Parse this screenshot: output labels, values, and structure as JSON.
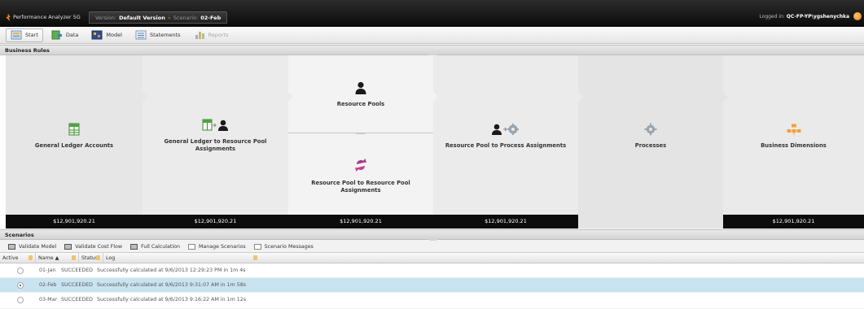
{
  "app": {
    "title": "Performance Analyzer 5G",
    "version_label": "Version:",
    "version_value": "Default Version",
    "scenario_label": "Scenario:",
    "scenario_value": "02-Feb",
    "logged_label": "Logged in:",
    "logged_user": "QC-FP-YP\\ygshenychka"
  },
  "toolbar": {
    "start": "Start",
    "data": "Data",
    "model": "Model",
    "statements": "Statements",
    "reports": "Reports"
  },
  "business_rules": {
    "header": "Business Rules",
    "gl_accounts": {
      "label": "General Ledger Accounts",
      "total": "$12,901,920.21"
    },
    "gl_to_rp": {
      "label": "General Ledger to Resource Pool Assignments",
      "total": "$12,901,920.21"
    },
    "resource_pools": {
      "label": "Resource Pools",
      "total": "$12,901,920.21"
    },
    "rp_to_rp": {
      "label": "Resource Pool to Resource Pool Assignments"
    },
    "rp_to_process": {
      "label": "Resource Pool to Process Assignments",
      "total": "$12,901,920.21"
    },
    "processes": {
      "label": "Processes"
    },
    "business_dimensions": {
      "label": "Business Dimensions",
      "total": "$12,901,920.21"
    }
  },
  "scenarios": {
    "header": "Scenarios",
    "toolbar": {
      "validate_model": "Validate Model",
      "validate_cost_flow": "Validate Cost Flow",
      "full_calculation": "Full Calculation",
      "manage_scenarios": "Manage Scenarios",
      "scenario_messages": "Scenario Messages"
    },
    "columns": {
      "active": "Active",
      "name": "Name",
      "status": "Status",
      "log": "Log"
    },
    "rows": [
      {
        "name": "01-Jan",
        "status": "SUCCEEDED",
        "log": "Successfully calculated at 9/6/2013 12:29:23 PM in 1m 4s",
        "active": false
      },
      {
        "name": "02-Feb",
        "status": "SUCCEEDED",
        "log": "Successfully calculated at 9/6/2013 9:31:07 AM in 1m 58s",
        "active": true
      },
      {
        "name": "03-Mar",
        "status": "SUCCEEDED",
        "log": "Successfully calculated at 9/6/2013 9:16:22 AM in 1m 12s",
        "active": false
      }
    ]
  },
  "colors": {
    "accent_orange": "#e07d16",
    "selected_row": "#c9e3f0",
    "total_bar": "#0c0c0c"
  }
}
